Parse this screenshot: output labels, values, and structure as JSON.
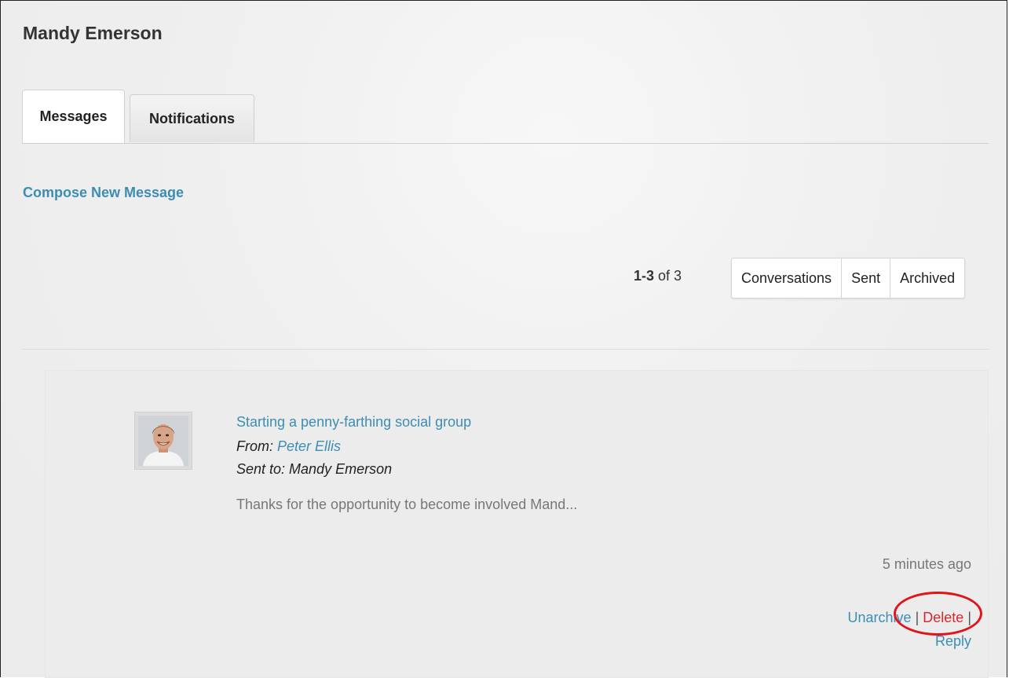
{
  "header": {
    "title": "Mandy Emerson"
  },
  "tabs": [
    {
      "label": "Messages",
      "active": true
    },
    {
      "label": "Notifications",
      "active": false
    }
  ],
  "compose": {
    "label": "Compose New Message"
  },
  "pager": {
    "range": "1-3",
    "of_text": "of 3"
  },
  "filters": [
    {
      "label": "Conversations"
    },
    {
      "label": "Sent"
    },
    {
      "label": "Archived"
    }
  ],
  "message": {
    "subject": "Starting a penny-farthing social group",
    "from_prefix": "From:",
    "from_name": "Peter Ellis",
    "sent_to": "Sent to: Mandy Emerson",
    "preview": "Thanks for the opportunity to become involved Mand...",
    "time": "5 minutes ago",
    "actions": {
      "unarchive": "Unarchive",
      "delete": "Delete",
      "reply": "Reply",
      "separator": "|"
    }
  },
  "colors": {
    "link": "#3c8db4",
    "delete": "#d8262b",
    "annotation": "#e1141b"
  },
  "icons": {
    "avatar": "user-avatar-photo"
  }
}
